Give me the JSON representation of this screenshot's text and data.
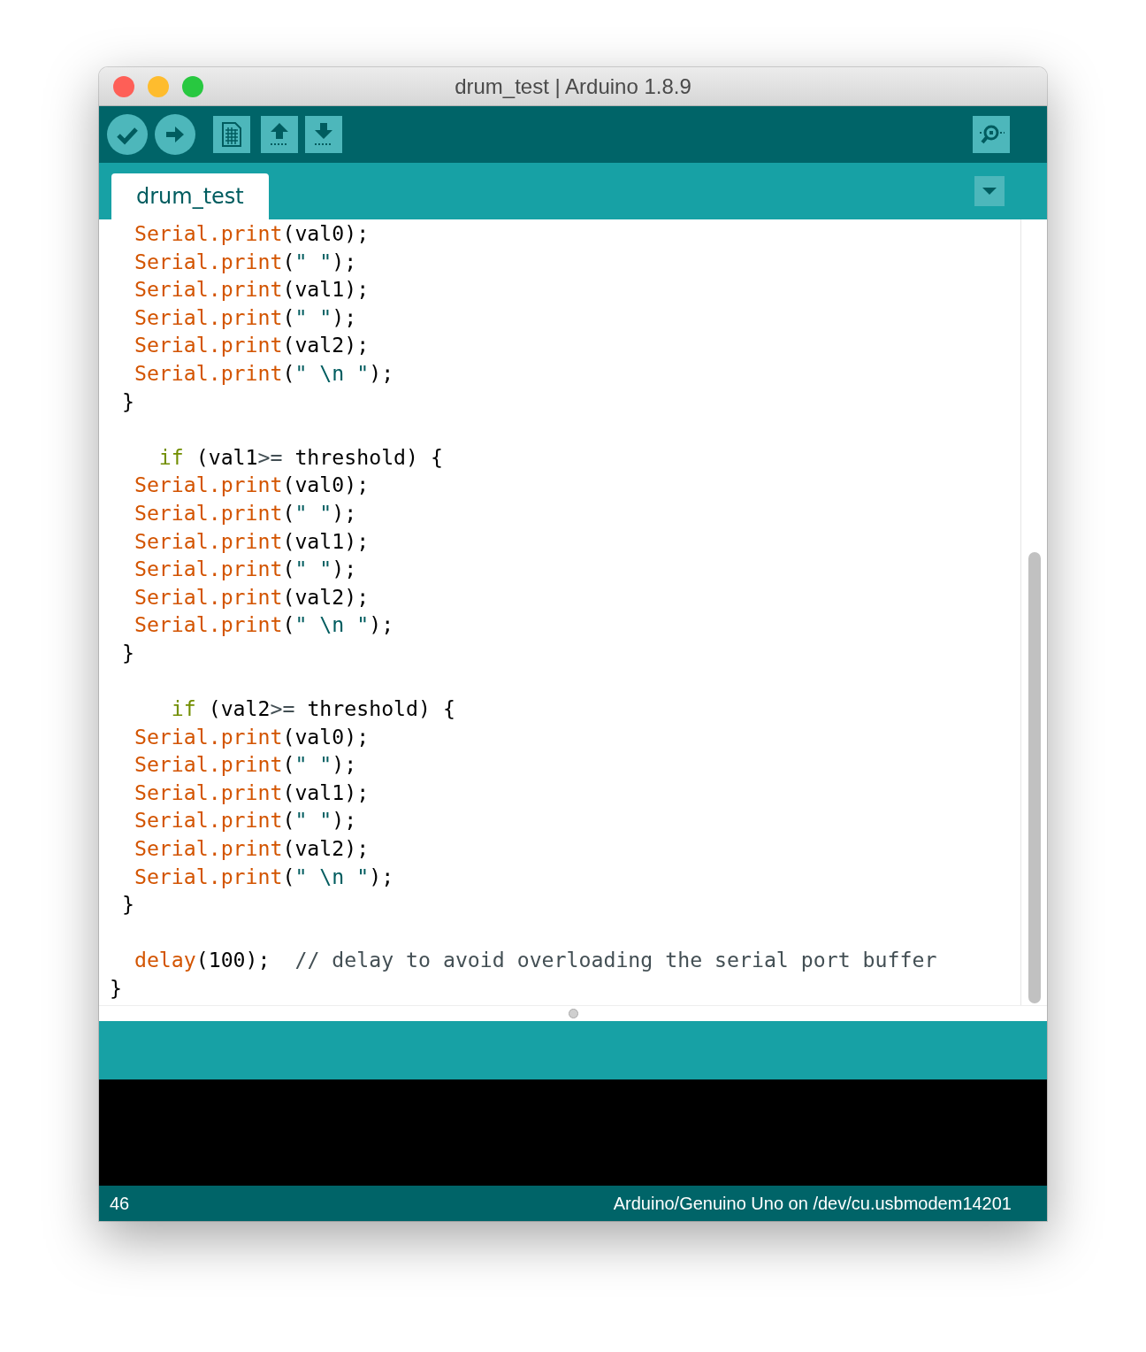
{
  "window": {
    "title": "drum_test | Arduino 1.8.9"
  },
  "toolbar": {
    "buttons": [
      {
        "kind": "verify"
      },
      {
        "kind": "upload"
      },
      {
        "kind": "new"
      },
      {
        "kind": "open"
      },
      {
        "kind": "save"
      }
    ],
    "serial_monitor": {
      "kind": "monitor"
    }
  },
  "tabs": [
    {
      "label": "drum_test",
      "selected": true
    }
  ],
  "editor": {
    "lines": [
      {
        "kind": "code",
        "tokens": [
          {
            "t": "  Serial.print",
            "kind": "fn"
          },
          {
            "t": "(val0);",
            "kind": "plain"
          }
        ]
      },
      {
        "kind": "code",
        "tokens": [
          {
            "t": "  Serial.print",
            "kind": "fn"
          },
          {
            "t": "(",
            "kind": "plain"
          },
          {
            "t": "\" \"",
            "kind": "str"
          },
          {
            "t": ");",
            "kind": "plain"
          }
        ]
      },
      {
        "kind": "code",
        "tokens": [
          {
            "t": "  Serial.print",
            "kind": "fn"
          },
          {
            "t": "(val1);",
            "kind": "plain"
          }
        ]
      },
      {
        "kind": "code",
        "tokens": [
          {
            "t": "  Serial.print",
            "kind": "fn"
          },
          {
            "t": "(",
            "kind": "plain"
          },
          {
            "t": "\" \"",
            "kind": "str"
          },
          {
            "t": ");",
            "kind": "plain"
          }
        ]
      },
      {
        "kind": "code",
        "tokens": [
          {
            "t": "  Serial.print",
            "kind": "fn"
          },
          {
            "t": "(val2);",
            "kind": "plain"
          }
        ]
      },
      {
        "kind": "code",
        "tokens": [
          {
            "t": "  Serial.print",
            "kind": "fn"
          },
          {
            "t": "(",
            "kind": "plain"
          },
          {
            "t": "\" \\n \"",
            "kind": "str"
          },
          {
            "t": ");",
            "kind": "plain"
          }
        ]
      },
      {
        "kind": "code",
        "tokens": [
          {
            "t": " }",
            "kind": "plain"
          }
        ]
      },
      {
        "kind": "blank"
      },
      {
        "kind": "code",
        "tokens": [
          {
            "t": "    if",
            "kind": "kw"
          },
          {
            "t": " (val1",
            "kind": "plain"
          },
          {
            "t": ">=",
            "kind": "op"
          },
          {
            "t": " threshold) {",
            "kind": "plain"
          }
        ]
      },
      {
        "kind": "code",
        "tokens": [
          {
            "t": "  Serial.print",
            "kind": "fn"
          },
          {
            "t": "(val0);",
            "kind": "plain"
          }
        ]
      },
      {
        "kind": "code",
        "tokens": [
          {
            "t": "  Serial.print",
            "kind": "fn"
          },
          {
            "t": "(",
            "kind": "plain"
          },
          {
            "t": "\" \"",
            "kind": "str"
          },
          {
            "t": ");",
            "kind": "plain"
          }
        ]
      },
      {
        "kind": "code",
        "tokens": [
          {
            "t": "  Serial.print",
            "kind": "fn"
          },
          {
            "t": "(val1);",
            "kind": "plain"
          }
        ]
      },
      {
        "kind": "code",
        "tokens": [
          {
            "t": "  Serial.print",
            "kind": "fn"
          },
          {
            "t": "(",
            "kind": "plain"
          },
          {
            "t": "\" \"",
            "kind": "str"
          },
          {
            "t": ");",
            "kind": "plain"
          }
        ]
      },
      {
        "kind": "code",
        "tokens": [
          {
            "t": "  Serial.print",
            "kind": "fn"
          },
          {
            "t": "(val2);",
            "kind": "plain"
          }
        ]
      },
      {
        "kind": "code",
        "tokens": [
          {
            "t": "  Serial.print",
            "kind": "fn"
          },
          {
            "t": "(",
            "kind": "plain"
          },
          {
            "t": "\" \\n \"",
            "kind": "str"
          },
          {
            "t": ");",
            "kind": "plain"
          }
        ]
      },
      {
        "kind": "code",
        "tokens": [
          {
            "t": " }",
            "kind": "plain"
          }
        ]
      },
      {
        "kind": "blank"
      },
      {
        "kind": "code",
        "tokens": [
          {
            "t": "     if",
            "kind": "kw"
          },
          {
            "t": " (val2",
            "kind": "plain"
          },
          {
            "t": ">=",
            "kind": "op"
          },
          {
            "t": " threshold) {",
            "kind": "plain"
          }
        ]
      },
      {
        "kind": "code",
        "tokens": [
          {
            "t": "  Serial.print",
            "kind": "fn"
          },
          {
            "t": "(val0);",
            "kind": "plain"
          }
        ]
      },
      {
        "kind": "code",
        "tokens": [
          {
            "t": "  Serial.print",
            "kind": "fn"
          },
          {
            "t": "(",
            "kind": "plain"
          },
          {
            "t": "\" \"",
            "kind": "str"
          },
          {
            "t": ");",
            "kind": "plain"
          }
        ]
      },
      {
        "kind": "code",
        "tokens": [
          {
            "t": "  Serial.print",
            "kind": "fn"
          },
          {
            "t": "(val1);",
            "kind": "plain"
          }
        ]
      },
      {
        "kind": "code",
        "tokens": [
          {
            "t": "  Serial.print",
            "kind": "fn"
          },
          {
            "t": "(",
            "kind": "plain"
          },
          {
            "t": "\" \"",
            "kind": "str"
          },
          {
            "t": ");",
            "kind": "plain"
          }
        ]
      },
      {
        "kind": "code",
        "tokens": [
          {
            "t": "  Serial.print",
            "kind": "fn"
          },
          {
            "t": "(val2);",
            "kind": "plain"
          }
        ]
      },
      {
        "kind": "code",
        "tokens": [
          {
            "t": "  Serial.print",
            "kind": "fn"
          },
          {
            "t": "(",
            "kind": "plain"
          },
          {
            "t": "\" \\n \"",
            "kind": "str"
          },
          {
            "t": ");",
            "kind": "plain"
          }
        ]
      },
      {
        "kind": "code",
        "tokens": [
          {
            "t": " }",
            "kind": "plain"
          }
        ]
      },
      {
        "kind": "blank"
      },
      {
        "kind": "code",
        "tokens": [
          {
            "t": "  delay",
            "kind": "fn"
          },
          {
            "t": "(100);  ",
            "kind": "plain"
          },
          {
            "t": "// delay to avoid overloading the serial port buffer",
            "kind": "comment"
          }
        ]
      },
      {
        "kind": "code",
        "tokens": [
          {
            "t": "}",
            "kind": "plain"
          }
        ]
      }
    ]
  },
  "status_bar": {
    "line": "46",
    "board": "Arduino/Genuino Uno on /dev/cu.usbmodem14201"
  }
}
